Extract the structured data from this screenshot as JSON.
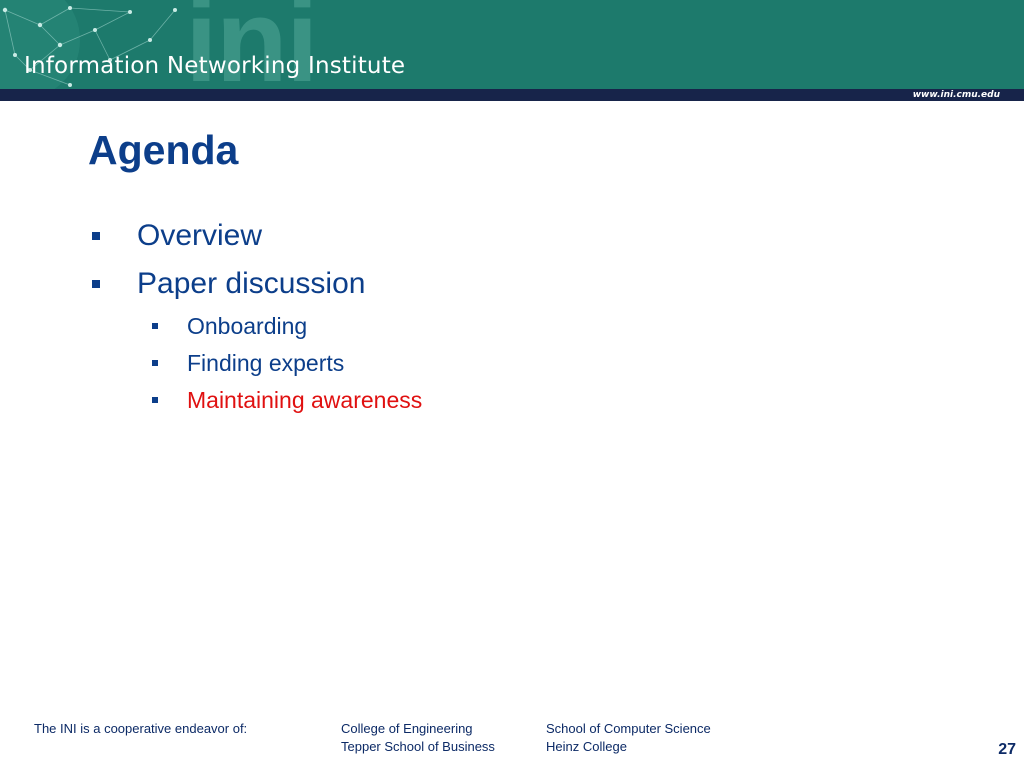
{
  "header": {
    "watermark": "ini",
    "institute_name": "Information Networking Institute",
    "url": "www.ini.cmu.edu",
    "colors": {
      "banner": "#1d7a6c",
      "navy_bar": "#17244a"
    }
  },
  "slide": {
    "title": "Agenda",
    "bullets": [
      {
        "text": "Overview",
        "level": 1,
        "color": "#0c3e8a"
      },
      {
        "text": "Paper discussion",
        "level": 1,
        "color": "#0c3e8a"
      },
      {
        "text": "Onboarding",
        "level": 2,
        "color": "#0c3e8a"
      },
      {
        "text": "Finding experts",
        "level": 2,
        "color": "#0c3e8a"
      },
      {
        "text": "Maintaining awareness",
        "level": 2,
        "color": "#e01010"
      }
    ]
  },
  "footer": {
    "lead": "The INI is a cooperative endeavor of:",
    "col1": [
      "College of Engineering",
      "Tepper School of Business"
    ],
    "col2": [
      "School of Computer Science",
      "Heinz College"
    ],
    "page_number": "27"
  }
}
